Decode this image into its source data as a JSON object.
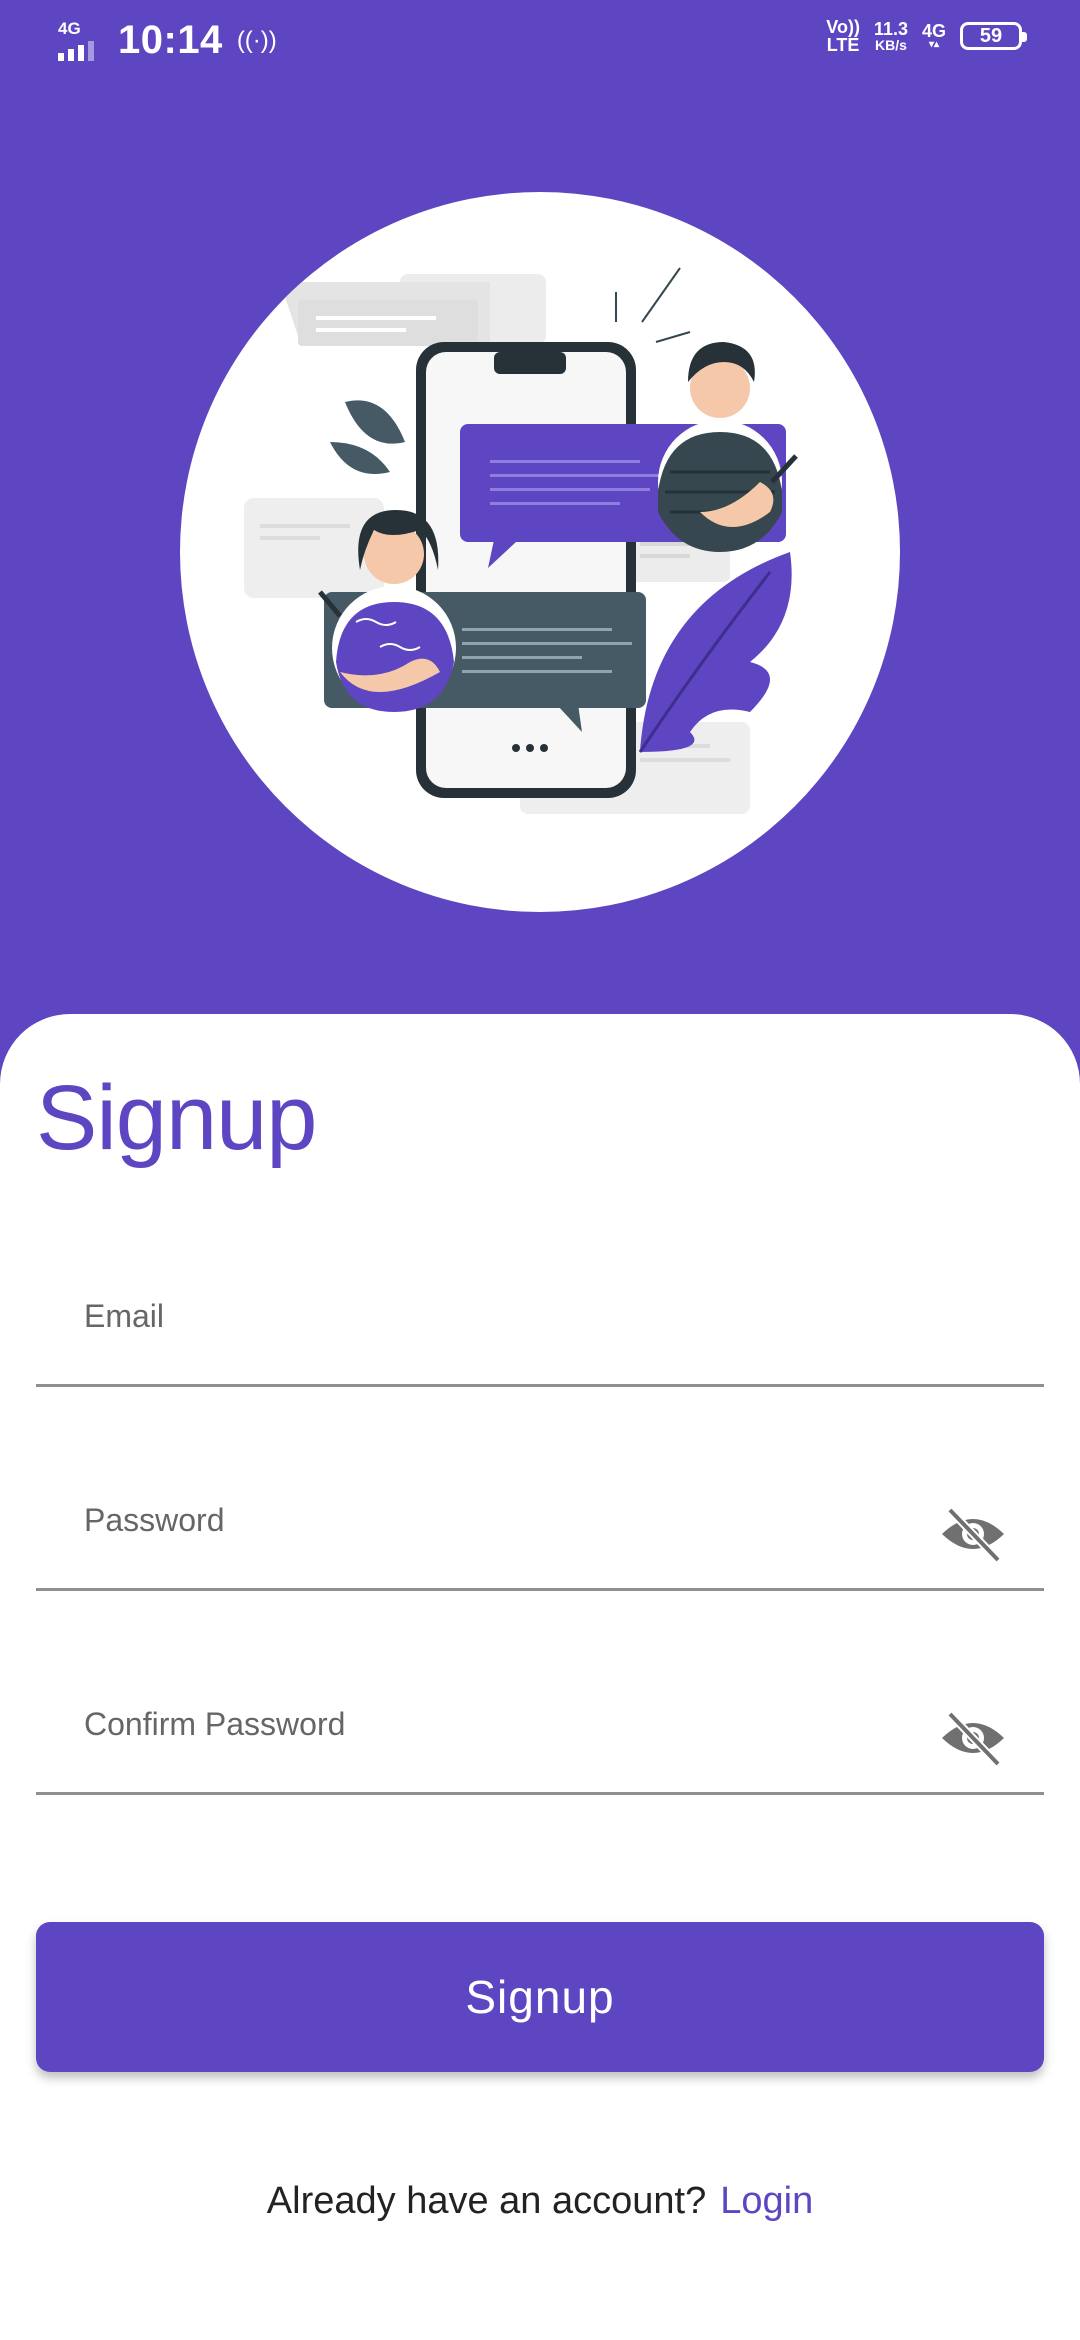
{
  "status_bar": {
    "network_left": "4G",
    "time": "10:14",
    "hotspot": "((·))",
    "volte_top": "Vo))",
    "volte_bottom": "LTE",
    "speed_value": "11.3",
    "speed_unit": "KB/s",
    "network_right": "4G",
    "battery": "59"
  },
  "illustration": {
    "name": "chat-illustration"
  },
  "form": {
    "title": "Signup",
    "email_placeholder": "Email",
    "password_placeholder": "Password",
    "confirm_password_placeholder": "Confirm Password",
    "submit_label": "Signup"
  },
  "footer": {
    "prompt": "Already have an account?",
    "login_label": "Login"
  },
  "colors": {
    "accent": "#5e45c2",
    "illustration_dark": "#455a64"
  }
}
